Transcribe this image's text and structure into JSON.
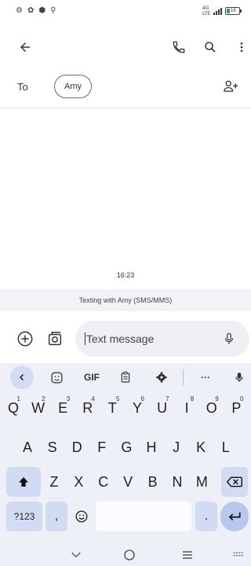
{
  "status_bar": {
    "network_top": "4G",
    "network_bottom": "LTE",
    "battery": "16"
  },
  "header": {
    "recipient_label": "To",
    "recipient_chip": "Amy"
  },
  "conversation": {
    "timestamp": "16:23",
    "texting_banner": "Texting with Amy (SMS/MMS)"
  },
  "compose": {
    "placeholder": "Text message"
  },
  "keyboard": {
    "toolbar": {
      "gif_label": "GIF",
      "more_label": "···"
    },
    "row1": [
      {
        "key": "Q",
        "hint": "1"
      },
      {
        "key": "W",
        "hint": "2"
      },
      {
        "key": "E",
        "hint": "3"
      },
      {
        "key": "R",
        "hint": "4"
      },
      {
        "key": "T",
        "hint": "5"
      },
      {
        "key": "Y",
        "hint": "6"
      },
      {
        "key": "U",
        "hint": "7"
      },
      {
        "key": "I",
        "hint": "8"
      },
      {
        "key": "O",
        "hint": "9"
      },
      {
        "key": "P",
        "hint": "0"
      }
    ],
    "row2": [
      "A",
      "S",
      "D",
      "F",
      "G",
      "H",
      "J",
      "K",
      "L"
    ],
    "row3": [
      "Z",
      "X",
      "C",
      "V",
      "B",
      "N",
      "M"
    ],
    "symbols_label": "?123",
    "comma_label": ",",
    "period_label": "."
  },
  "colors": {
    "accent": "#d3dbf2",
    "enter_key": "#b9c7f0",
    "keyboard_bg": "#eef0f7",
    "banner_bg": "#f1f3f6"
  }
}
